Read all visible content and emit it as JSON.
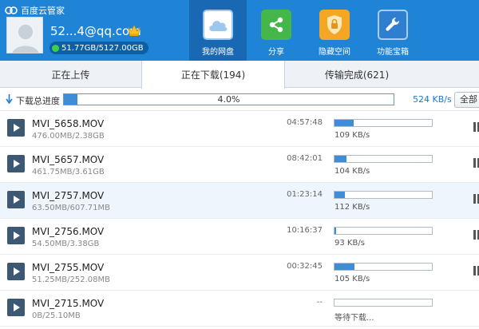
{
  "app": {
    "title": "百度云管家"
  },
  "user": {
    "name": "52...4@qq.com",
    "quota": "51.77GB/5127.00GB"
  },
  "nav": [
    {
      "label": "我的网盘",
      "icon": "cloud-icon",
      "active": true
    },
    {
      "label": "分享",
      "icon": "share-icon",
      "active": false
    },
    {
      "label": "隐藏空间",
      "icon": "lock-icon",
      "active": false
    },
    {
      "label": "功能宝箱",
      "icon": "wrench-icon",
      "active": false
    }
  ],
  "tabs": [
    {
      "label": "正在上传",
      "active": false
    },
    {
      "label": "正在下载(194)",
      "active": true
    },
    {
      "label": "传输完成(621)",
      "active": false
    }
  ],
  "total": {
    "label": "下载总进度",
    "percent_text": "4.0%",
    "progress": 0.04,
    "speed": "524 KB/s",
    "all_button": "全部"
  },
  "downloads": [
    {
      "name": "MVI_5658.MOV",
      "size": "476.00MB/2.38GB",
      "remaining": "04:57:48",
      "speed": "109 KB/s",
      "progress": 0.195,
      "highlight": false
    },
    {
      "name": "MVI_5657.MOV",
      "size": "461.75MB/3.61GB",
      "remaining": "08:42:01",
      "speed": "104 KB/s",
      "progress": 0.125,
      "highlight": false
    },
    {
      "name": "MVI_2757.MOV",
      "size": "63.50MB/607.71MB",
      "remaining": "01:23:14",
      "speed": "112 KB/s",
      "progress": 0.104,
      "highlight": true
    },
    {
      "name": "MVI_2756.MOV",
      "size": "54.50MB/3.38GB",
      "remaining": "10:16:37",
      "speed": "93 KB/s",
      "progress": 0.016,
      "highlight": false
    },
    {
      "name": "MVI_2755.MOV",
      "size": "51.25MB/252.08MB",
      "remaining": "00:32:45",
      "speed": "105 KB/s",
      "progress": 0.203,
      "highlight": false
    },
    {
      "name": "MVI_2715.MOV",
      "size": "0B/25.10MB",
      "remaining": "--",
      "speed": "等待下载...",
      "progress": 0,
      "highlight": false
    }
  ],
  "colors": {
    "header": "#1f83d6",
    "nav_active": "#1968b4",
    "progress": "#3f8dd6",
    "speed_text": "#1a78d0"
  }
}
